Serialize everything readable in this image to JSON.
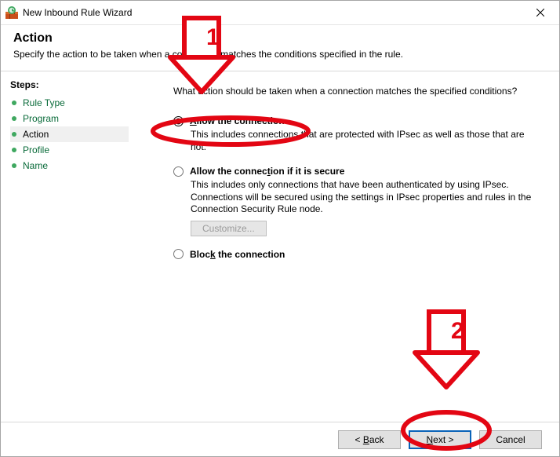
{
  "window": {
    "title": "New Inbound Rule Wizard"
  },
  "header": {
    "title": "Action",
    "subtitle": "Specify the action to be taken when a connection matches the conditions specified in the rule."
  },
  "sidebar": {
    "steps_label": "Steps:",
    "items": [
      {
        "label": "Rule Type",
        "current": false
      },
      {
        "label": "Program",
        "current": false
      },
      {
        "label": "Action",
        "current": true
      },
      {
        "label": "Profile",
        "current": false
      },
      {
        "label": "Name",
        "current": false
      }
    ]
  },
  "content": {
    "prompt": "What action should be taken when a connection matches the specified conditions?",
    "options": [
      {
        "id": "allow",
        "label": "Allow the connection",
        "underline_index": 0,
        "desc": "This includes connections that are protected with IPsec as well as those that are not.",
        "selected": true
      },
      {
        "id": "allow-secure",
        "label": "Allow the connection if it is secure",
        "underline_index": 16,
        "desc": "This includes only connections that have been authenticated by using IPsec. Connections will be secured using the settings in IPsec properties and rules in the Connection Security Rule node.",
        "selected": false,
        "has_customize": true
      },
      {
        "id": "block",
        "label": "Block the connection",
        "underline_index": 4,
        "desc": "",
        "selected": false
      }
    ],
    "customize_label": "Customize..."
  },
  "footer": {
    "back": "< Back",
    "next": "Next >",
    "cancel": "Cancel"
  },
  "annotations": {
    "n1": "1",
    "n2": "2"
  }
}
